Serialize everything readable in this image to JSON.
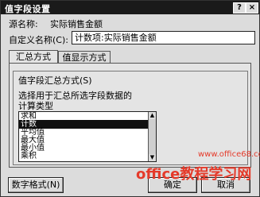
{
  "dialog": {
    "title": "值字段设置",
    "help_glyph": "?",
    "close_glyph": "×"
  },
  "source": {
    "label": "源名称:",
    "value": "实际销售金额"
  },
  "custom_name": {
    "label": "自定义名称(C):",
    "value": "计数项:实际销售金额"
  },
  "tabs": [
    {
      "label": "汇总方式",
      "active": true
    },
    {
      "label": "值显示方式",
      "active": false
    }
  ],
  "summary_group": {
    "title": "值字段汇总方式(S)",
    "instruction_line1": "选择用于汇总所选字段数据的",
    "instruction_line2": "计算类型",
    "items": [
      "求和",
      "计数",
      "平均值",
      "最大值",
      "最小值",
      "乘积"
    ],
    "selected_index": 1
  },
  "buttons": {
    "number_format": "数字格式(N)",
    "ok": "确定",
    "cancel": "取消"
  },
  "watermark": {
    "text": "office教程学习网",
    "url": "www.office68.com"
  },
  "colors": {
    "titlebar": "#1a1a1a",
    "selection": "#111111",
    "watermark": "#e53a2a"
  }
}
